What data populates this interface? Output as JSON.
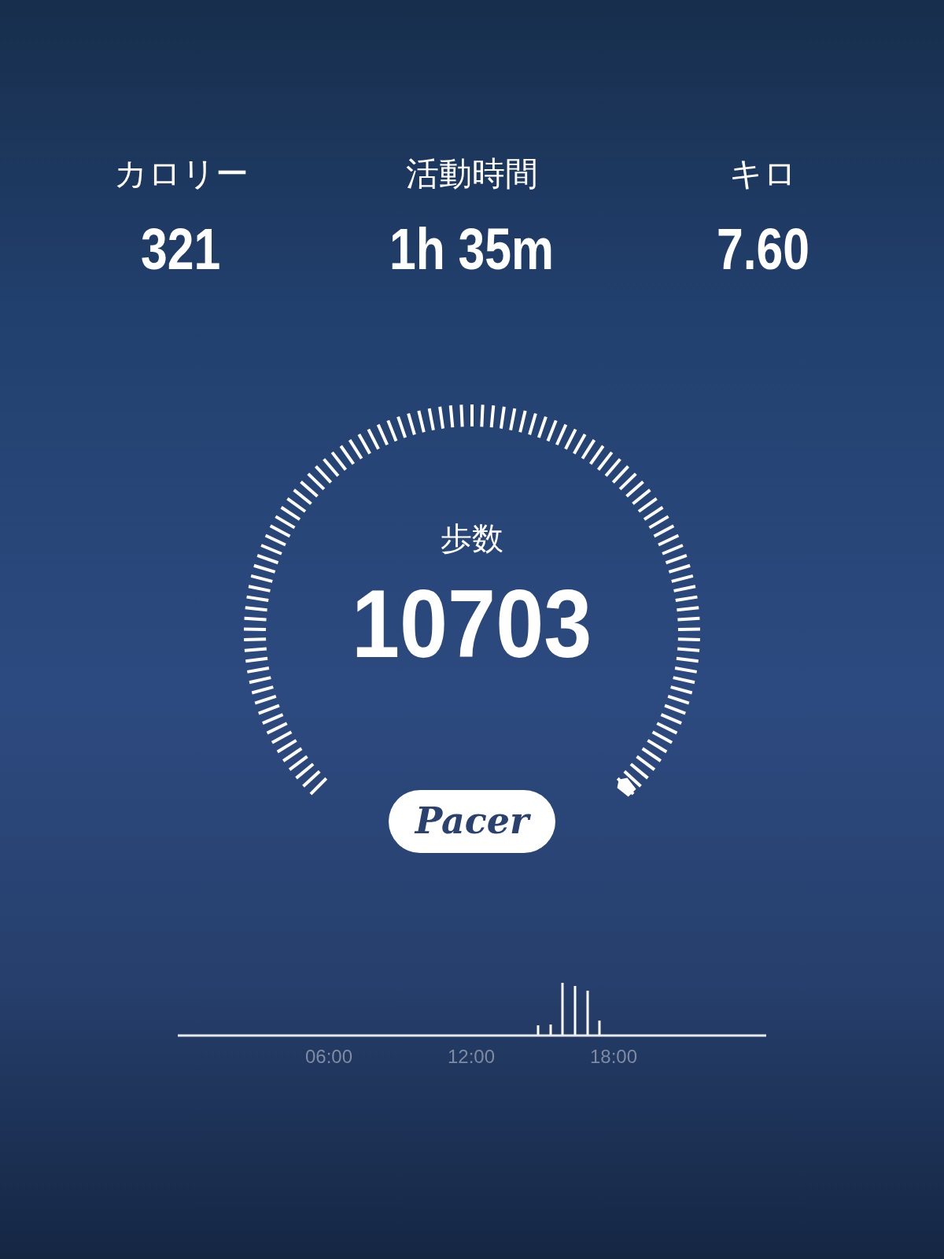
{
  "stats": [
    {
      "label": "カロリー",
      "value": "321"
    },
    {
      "label": "活動時間",
      "value": "1h 35m"
    },
    {
      "label": "キロ",
      "value": "7.60"
    }
  ],
  "gauge": {
    "label": "歩数",
    "value": "10703"
  },
  "logo": {
    "text": "Pacer"
  },
  "activity_chart": {
    "axis_labels": [
      "06:00",
      "12:00",
      "18:00"
    ]
  }
}
